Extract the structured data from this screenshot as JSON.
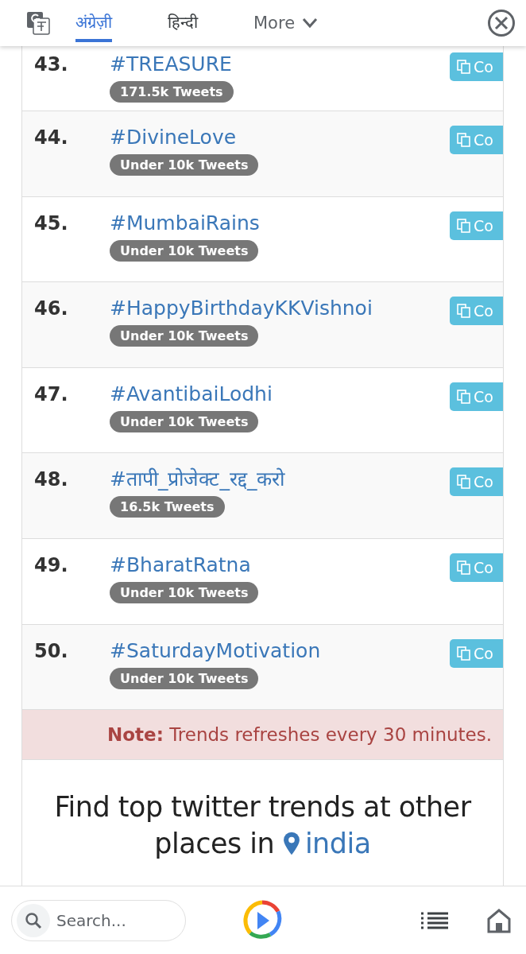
{
  "translate_bar": {
    "tabs": [
      {
        "label": "अंग्रेज़ी",
        "selected": true
      },
      {
        "label": "हिन्दी",
        "selected": false
      }
    ],
    "more": "More"
  },
  "trends": [
    {
      "rank": "43.",
      "hashtag": "#TREASURE",
      "tweets": "171.5k Tweets",
      "copy": "Co"
    },
    {
      "rank": "44.",
      "hashtag": "#DivineLove",
      "tweets": "Under 10k Tweets",
      "copy": "Co"
    },
    {
      "rank": "45.",
      "hashtag": "#MumbaiRains",
      "tweets": "Under 10k Tweets",
      "copy": "Co"
    },
    {
      "rank": "46.",
      "hashtag": "#HappyBirthdayKKVishnoi",
      "tweets": "Under 10k Tweets",
      "copy": "Co"
    },
    {
      "rank": "47.",
      "hashtag": "#AvantibaiLodhi",
      "tweets": "Under 10k Tweets",
      "copy": "Co"
    },
    {
      "rank": "48.",
      "hashtag": "#तापी_प्रोजेक्ट_रद्द_करो",
      "tweets": "16.5k Tweets",
      "copy": "Co"
    },
    {
      "rank": "49.",
      "hashtag": "#BharatRatna",
      "tweets": "Under 10k Tweets",
      "copy": "Co"
    },
    {
      "rank": "50.",
      "hashtag": "#SaturdayMotivation",
      "tweets": "Under 10k Tweets",
      "copy": "Co"
    }
  ],
  "note": "**Note:** Trends refreshes every 30 minutes.",
  "heading": {
    "text": "Find top twitter trends at other places in",
    "location": "india"
  },
  "bottom_bar": {
    "search": {
      "placeholder": "Search..."
    }
  }
}
